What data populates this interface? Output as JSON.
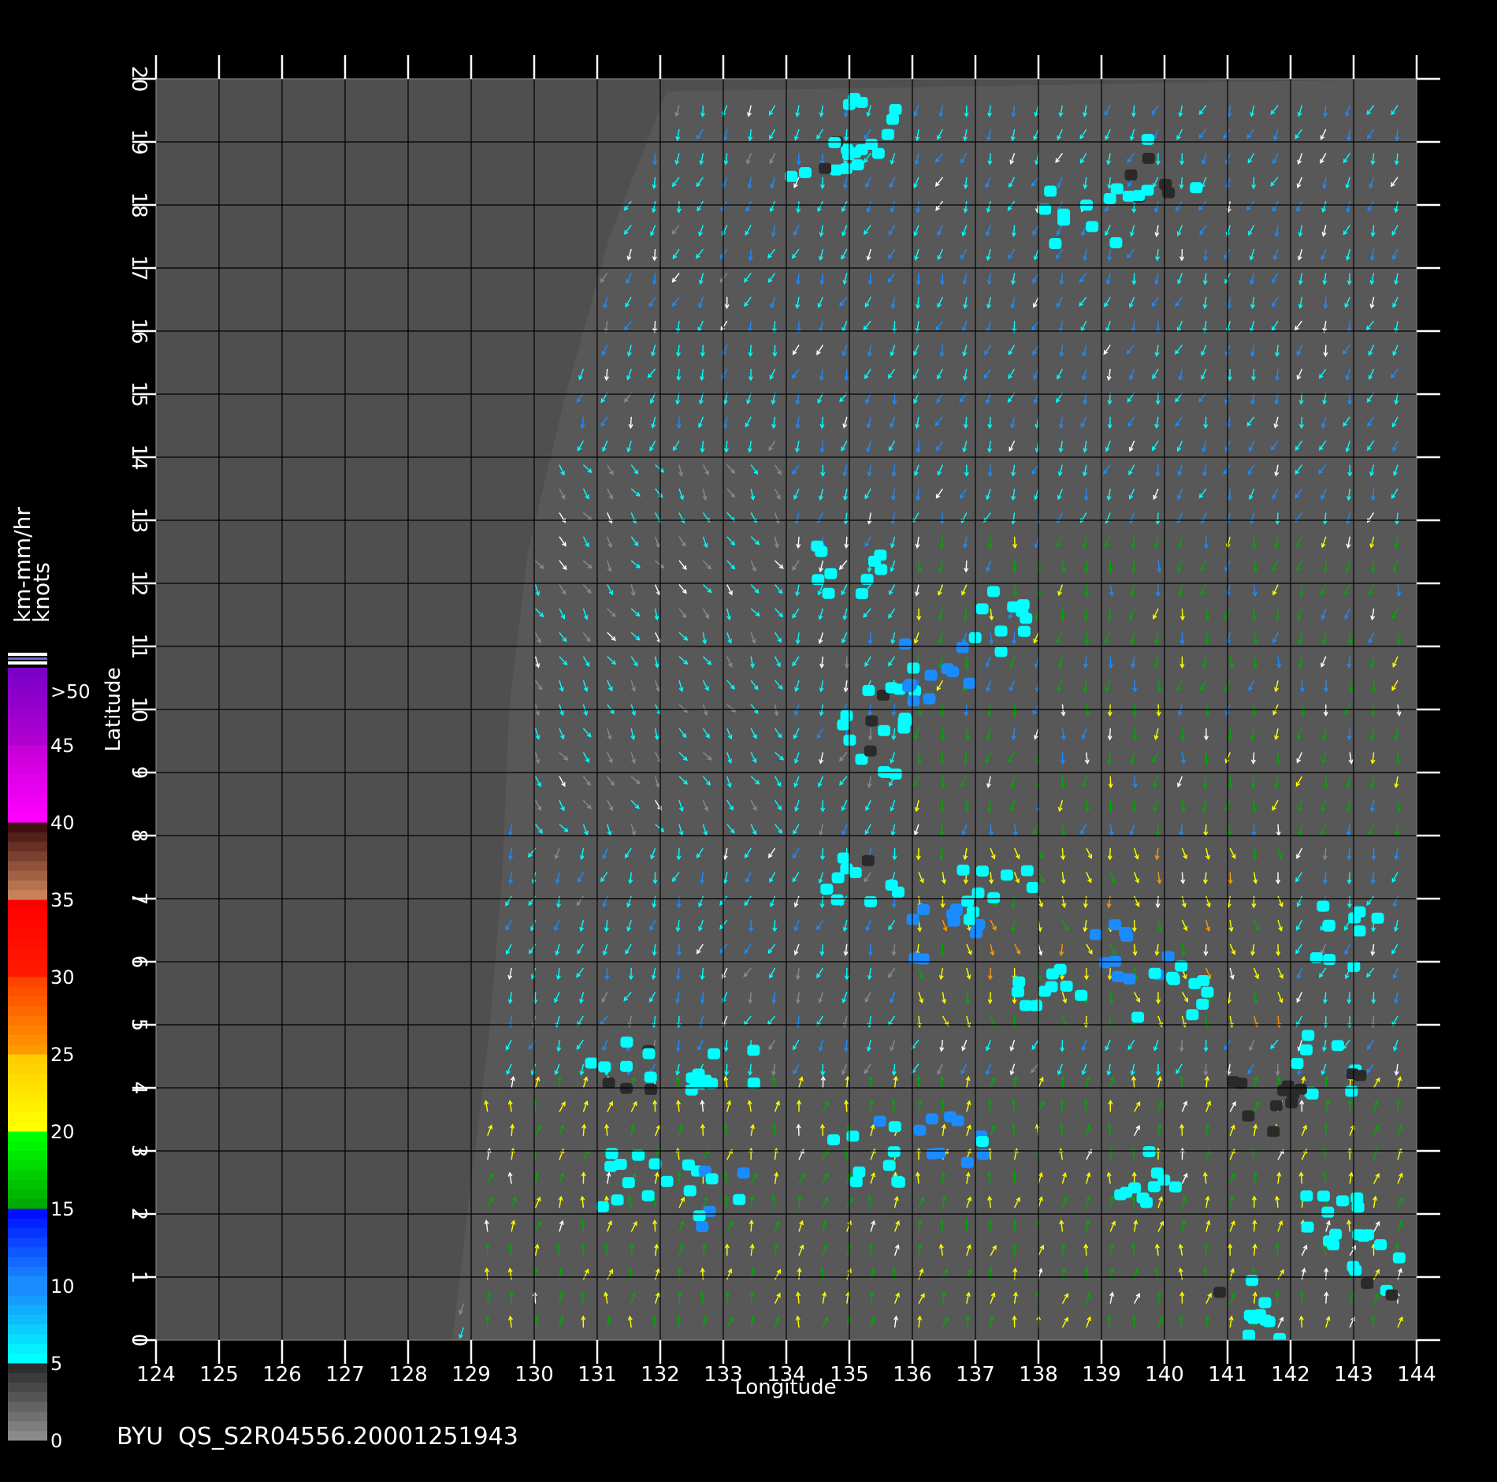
{
  "footer": {
    "product_label": "BYU  QS_S2R04556.20001251943"
  },
  "colorbar": {
    "unit_line1": "km-mm/hr",
    "unit_line2": "knots",
    "ticks": [
      "0",
      "5",
      "10",
      "15",
      "20",
      "25",
      "30",
      "35",
      "40",
      "45",
      ">50"
    ],
    "segments": [
      {
        "from": 0,
        "to": 5,
        "colors": [
          "#8a8a8a",
          "#2e2e2e"
        ]
      },
      {
        "from": 5,
        "to": 10,
        "colors": [
          "#00ffff",
          "#1a8cff"
        ]
      },
      {
        "from": 10,
        "to": 15,
        "colors": [
          "#1a8cff",
          "#0010ff"
        ]
      },
      {
        "from": 15,
        "to": 20,
        "colors": [
          "#00aa00",
          "#00ff00"
        ]
      },
      {
        "from": 20,
        "to": 25,
        "colors": [
          "#ffff00",
          "#ffcc00"
        ]
      },
      {
        "from": 25,
        "to": 30,
        "colors": [
          "#ff9900",
          "#ff4400"
        ]
      },
      {
        "from": 30,
        "to": 35,
        "colors": [
          "#ff1a00",
          "#ff0000"
        ]
      },
      {
        "from": 35,
        "to": 40,
        "colors": [
          "#c8825a",
          "#401010"
        ]
      },
      {
        "from": 40,
        "to": 45,
        "colors": [
          "#ff00ff",
          "#c800d8"
        ]
      },
      {
        "from": 45,
        "to": 50,
        "colors": [
          "#b000d0",
          "#7a00c8"
        ]
      }
    ]
  },
  "chart_data": {
    "type": "scatter",
    "subtype": "wind-vector and rain-rate swath map",
    "xlabel": "Longitude",
    "ylabel": "Latitude",
    "xlim": [
      124,
      144
    ],
    "ylim": [
      0,
      20
    ],
    "xticks": [
      "124",
      "125",
      "126",
      "127",
      "128",
      "129",
      "130",
      "131",
      "132",
      "133",
      "134",
      "135",
      "136",
      "137",
      "138",
      "139",
      "140",
      "141",
      "142",
      "143",
      "144"
    ],
    "yticks": [
      "0",
      "1",
      "2",
      "3",
      "4",
      "5",
      "6",
      "7",
      "8",
      "9",
      "10",
      "11",
      "12",
      "13",
      "14",
      "15",
      "16",
      "17",
      "18",
      "19",
      "20"
    ],
    "grid": true,
    "colors": {
      "background": "#000000",
      "plot_area": "#4f4f4f",
      "swath": "#585858",
      "grid": "#000000"
    },
    "swath_edge": [
      [
        132.1,
        19.8
      ],
      [
        131.2,
        17.5
      ],
      [
        130.5,
        15
      ],
      [
        129.9,
        12.5
      ],
      [
        129.6,
        10
      ],
      [
        129.5,
        7.5
      ],
      [
        129.3,
        5
      ],
      [
        129,
        2.5
      ],
      [
        128.7,
        0
      ]
    ],
    "rain_cells": [
      {
        "lon": 135.2,
        "lat": 19.2,
        "rate": 7
      },
      {
        "lon": 134.6,
        "lat": 18.6,
        "rate": 6
      },
      {
        "lon": 138.7,
        "lat": 17.8,
        "rate": 8
      },
      {
        "lon": 140,
        "lat": 18.6,
        "rate": 6
      },
      {
        "lon": 135,
        "lat": 12.1,
        "rate": 7
      },
      {
        "lon": 135.6,
        "lat": 10.2,
        "rate": 6
      },
      {
        "lon": 135.4,
        "lat": 9.4,
        "rate": 6
      },
      {
        "lon": 136.4,
        "lat": 10.6,
        "rate": 12
      },
      {
        "lon": 137.4,
        "lat": 11.4,
        "rate": 8
      },
      {
        "lon": 135.2,
        "lat": 7.4,
        "rate": 6
      },
      {
        "lon": 136.5,
        "lat": 6.5,
        "rate": 13
      },
      {
        "lon": 137.4,
        "lat": 7.1,
        "rate": 7
      },
      {
        "lon": 138.2,
        "lat": 5.4,
        "rate": 8
      },
      {
        "lon": 139.5,
        "lat": 6.2,
        "rate": 12
      },
      {
        "lon": 140.1,
        "lat": 5.6,
        "rate": 7
      },
      {
        "lon": 142.8,
        "lat": 6.4,
        "rate": 8
      },
      {
        "lon": 142.6,
        "lat": 4.4,
        "rate": 6
      },
      {
        "lon": 131.3,
        "lat": 4.3,
        "rate": 6
      },
      {
        "lon": 133,
        "lat": 4.1,
        "rate": 7
      },
      {
        "lon": 131.6,
        "lat": 2.6,
        "rate": 8
      },
      {
        "lon": 132.9,
        "lat": 2.3,
        "rate": 10
      },
      {
        "lon": 135.2,
        "lat": 3,
        "rate": 9
      },
      {
        "lon": 136.7,
        "lat": 3.2,
        "rate": 11
      },
      {
        "lon": 139.8,
        "lat": 2.6,
        "rate": 7
      },
      {
        "lon": 142.5,
        "lat": 1.8,
        "rate": 7
      },
      {
        "lon": 141.3,
        "lat": 0.5,
        "rate": 6
      },
      {
        "lon": 143.3,
        "lat": 1.2,
        "rate": 6
      },
      {
        "lon": 141.6,
        "lat": 3.6,
        "rate": 3
      }
    ],
    "wind_regimes": [
      {
        "lon_range": [
          134,
          144
        ],
        "lat_range": [
          13,
          20
        ],
        "direction_deg": 200,
        "speed_kt": 10
      },
      {
        "lon_range": [
          130,
          134
        ],
        "lat_range": [
          8,
          14
        ],
        "direction_deg": 150,
        "speed_kt": 6
      },
      {
        "lon_range": [
          136,
          144
        ],
        "lat_range": [
          8,
          13
        ],
        "direction_deg": 190,
        "speed_kt": 17
      },
      {
        "lon_range": [
          129,
          144
        ],
        "lat_range": [
          0,
          4
        ],
        "direction_deg": 10,
        "speed_kt": 20
      },
      {
        "lon_range": [
          136,
          142
        ],
        "lat_range": [
          5,
          8
        ],
        "direction_deg": 170,
        "speed_kt": 22
      }
    ]
  }
}
